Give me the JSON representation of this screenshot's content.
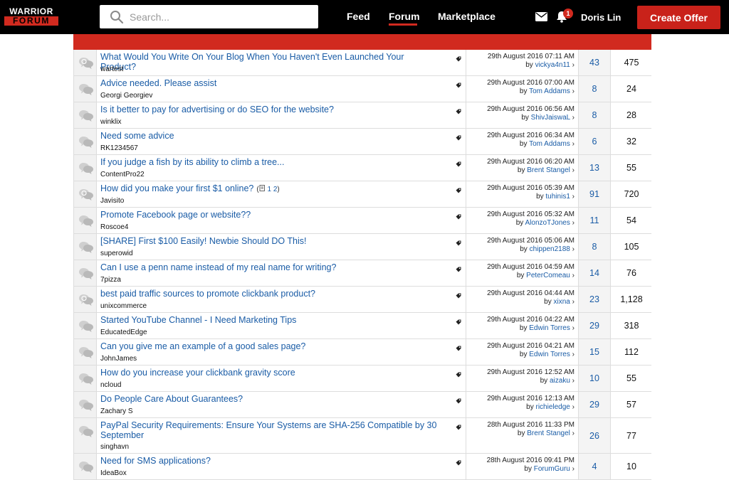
{
  "header": {
    "logo_top": "WARRIOR",
    "logo_bottom": "FORUM",
    "search_placeholder": "Search...",
    "nav": [
      {
        "label": "Feed"
      },
      {
        "label": "Forum"
      },
      {
        "label": "Marketplace"
      }
    ],
    "active_nav": "Forum",
    "notification_count": "1",
    "user_name": "Doris Lin",
    "create_offer_label": "Create Offer"
  },
  "colors": {
    "brand_red": "#d12a1f",
    "link_blue": "#1a5ca6",
    "header_bg": "#000000"
  },
  "threads": [
    {
      "title": "What Would You Write On Your Blog When You Haven't Even Launched Your Product?",
      "author": "wartest",
      "date": "29th August 2016 07:11 AM",
      "last_by": "vickya4n11",
      "replies": "43",
      "views": "475",
      "icon": "poll-chat-icon"
    },
    {
      "title": "Advice needed. Please assist",
      "author": "Georgi Georgiev",
      "date": "29th August 2016 07:00 AM",
      "last_by": "Tom Addams",
      "replies": "8",
      "views": "24",
      "icon": "chat-icon"
    },
    {
      "title": "Is it better to pay for advertising or do SEO for the website?",
      "author": "winklix",
      "date": "29th August 2016 06:56 AM",
      "last_by": "ShivJaiswaL",
      "replies": "8",
      "views": "28",
      "icon": "chat-icon"
    },
    {
      "title": "Need some advice",
      "author": "RK1234567",
      "date": "29th August 2016 06:34 AM",
      "last_by": "Tom Addams",
      "replies": "6",
      "views": "32",
      "icon": "chat-icon"
    },
    {
      "title": "If you judge a fish by its ability to climb a tree...",
      "author": "ContentPro22",
      "date": "29th August 2016 06:20 AM",
      "last_by": "Brent Stangel",
      "replies": "13",
      "views": "55",
      "icon": "chat-icon"
    },
    {
      "title": "How did you make your first $1 online?",
      "author": "Javisito",
      "date": "29th August 2016 05:39 AM",
      "last_by": "tuhinis1",
      "replies": "91",
      "views": "720",
      "icon": "poll-chat-icon",
      "pages": [
        "1",
        "2"
      ]
    },
    {
      "title": "Promote Facebook page or website??",
      "author": "Roscoe4",
      "date": "29th August 2016 05:32 AM",
      "last_by": "AlonzoTJones",
      "replies": "11",
      "views": "54",
      "icon": "chat-icon"
    },
    {
      "title": "[SHARE] First $100 Easily! Newbie Should DO This!",
      "author": "superowid",
      "date": "29th August 2016 05:06 AM",
      "last_by": "chippen2188",
      "replies": "8",
      "views": "105",
      "icon": "chat-icon"
    },
    {
      "title": "Can I use a penn name instead of my real name for writing?",
      "author": "7pizza",
      "date": "29th August 2016 04:59 AM",
      "last_by": "PeterComeau",
      "replies": "14",
      "views": "76",
      "icon": "chat-icon"
    },
    {
      "title": "best paid traffic sources to promote clickbank product?",
      "author": "unixcommerce",
      "date": "29th August 2016 04:44 AM",
      "last_by": "xixna",
      "replies": "23",
      "views": "1,128",
      "icon": "poll-chat-icon"
    },
    {
      "title": "Started YouTube Channel - I Need Marketing Tips",
      "author": "EducatedEdge",
      "date": "29th August 2016 04:22 AM",
      "last_by": "Edwin Torres",
      "replies": "29",
      "views": "318",
      "icon": "chat-icon"
    },
    {
      "title": "Can you give me an example of a good sales page?",
      "author": "JohnJames",
      "date": "29th August 2016 04:21 AM",
      "last_by": "Edwin Torres",
      "replies": "15",
      "views": "112",
      "icon": "chat-icon"
    },
    {
      "title": "How do you increase your clickbank gravity score",
      "author": "ncloud",
      "date": "29th August 2016 12:52 AM",
      "last_by": "aizaku",
      "replies": "10",
      "views": "55",
      "icon": "chat-icon"
    },
    {
      "title": "Do People Care About Guarantees?",
      "author": "Zachary S",
      "date": "29th August 2016 12:13 AM",
      "last_by": "richieledge",
      "replies": "29",
      "views": "57",
      "icon": "chat-icon"
    },
    {
      "title": "PayPal Security Requirements: Ensure Your Systems are SHA-256 Compatible by 30 September",
      "author": "singhavn",
      "date": "28th August 2016 11:33 PM",
      "last_by": "Brent Stangel",
      "replies": "26",
      "views": "77",
      "icon": "chat-icon",
      "tall": true
    },
    {
      "title": "Need for SMS applications?",
      "author": "IdeaBox",
      "date": "28th August 2016 09:41 PM",
      "last_by": "ForumGuru",
      "replies": "4",
      "views": "10",
      "icon": "chat-icon"
    }
  ],
  "labels": {
    "by": "by"
  }
}
